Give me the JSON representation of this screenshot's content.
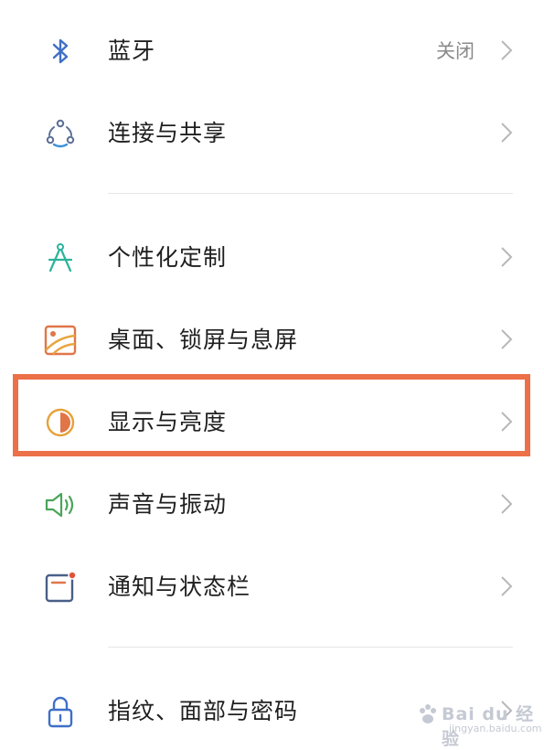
{
  "settings": {
    "items": [
      {
        "label": "蓝牙",
        "value": "关闭",
        "icon": "bluetooth-icon"
      },
      {
        "label": "连接与共享",
        "icon": "share-connect-icon"
      },
      {
        "label": "个性化定制",
        "icon": "compass-icon"
      },
      {
        "label": "桌面、锁屏与息屏",
        "icon": "wallpaper-icon"
      },
      {
        "label": "显示与亮度",
        "icon": "display-brightness-icon"
      },
      {
        "label": "声音与振动",
        "icon": "speaker-icon"
      },
      {
        "label": "通知与状态栏",
        "icon": "notification-icon"
      },
      {
        "label": "指纹、面部与密码",
        "icon": "lock-icon"
      }
    ]
  },
  "highlight_color": "#ec7048",
  "watermark": {
    "brand": "Bai du 经验",
    "site": "jingyan.baidu.com"
  }
}
